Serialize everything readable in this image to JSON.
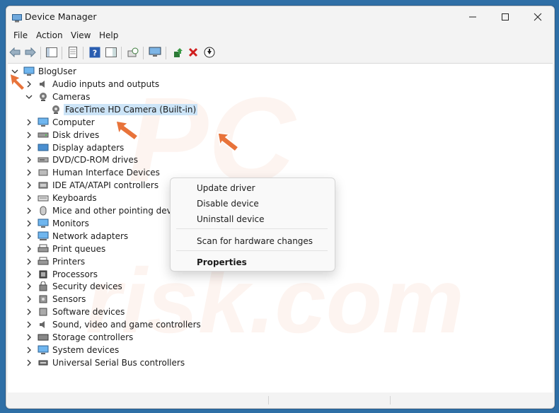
{
  "window": {
    "title": "Device Manager"
  },
  "menu": [
    "File",
    "Action",
    "View",
    "Help"
  ],
  "tree": {
    "root": "BlogUser",
    "nodes": [
      {
        "label": "Audio inputs and outputs",
        "icon": "speaker-icon",
        "expanded": false
      },
      {
        "label": "Cameras",
        "icon": "camera-icon",
        "expanded": true
      },
      {
        "label": "FaceTime HD Camera (Built-in)",
        "icon": "camera-icon",
        "child": true,
        "selected": true
      },
      {
        "label": "Computer",
        "icon": "monitor-icon",
        "expanded": false
      },
      {
        "label": "Disk drives",
        "icon": "disk-icon",
        "expanded": false
      },
      {
        "label": "Display adapters",
        "icon": "display-adapter-icon",
        "expanded": false
      },
      {
        "label": "DVD/CD-ROM drives",
        "icon": "dvd-icon",
        "expanded": false
      },
      {
        "label": "Human Interface Devices",
        "icon": "hid-icon",
        "expanded": false
      },
      {
        "label": "IDE ATA/ATAPI controllers",
        "icon": "controller-icon",
        "expanded": false
      },
      {
        "label": "Keyboards",
        "icon": "keyboard-icon",
        "expanded": false
      },
      {
        "label": "Mice and other pointing devices",
        "icon": "mouse-icon",
        "expanded": false
      },
      {
        "label": "Monitors",
        "icon": "monitor-icon",
        "expanded": false
      },
      {
        "label": "Network adapters",
        "icon": "network-icon",
        "expanded": false
      },
      {
        "label": "Print queues",
        "icon": "printer-icon",
        "expanded": false
      },
      {
        "label": "Printers",
        "icon": "printer-icon",
        "expanded": false
      },
      {
        "label": "Processors",
        "icon": "processor-icon",
        "expanded": false
      },
      {
        "label": "Security devices",
        "icon": "security-icon",
        "expanded": false
      },
      {
        "label": "Sensors",
        "icon": "sensor-icon",
        "expanded": false
      },
      {
        "label": "Software devices",
        "icon": "software-icon",
        "expanded": false
      },
      {
        "label": "Sound, video and game controllers",
        "icon": "speaker-icon",
        "expanded": false
      },
      {
        "label": "Storage controllers",
        "icon": "storage-icon",
        "expanded": false
      },
      {
        "label": "System devices",
        "icon": "system-icon",
        "expanded": false
      },
      {
        "label": "Universal Serial Bus controllers",
        "icon": "usb-icon",
        "expanded": false
      }
    ]
  },
  "context_menu": {
    "items": [
      "Update driver",
      "Disable device",
      "Uninstall device",
      "Scan for hardware changes",
      "Properties"
    ]
  },
  "watermark": {
    "line1": "PC",
    "line2": "risk.com"
  },
  "colors": {
    "accent": "#e8733a",
    "selection": "#cce4f7"
  }
}
